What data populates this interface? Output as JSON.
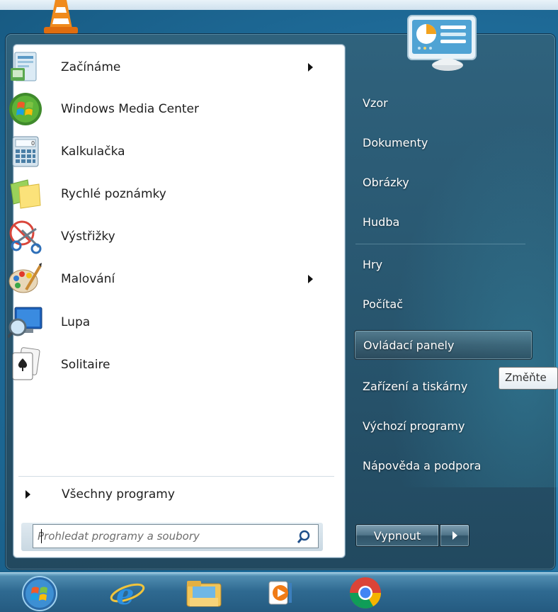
{
  "left_programs": [
    {
      "label": "Začínáme",
      "icon": "getting-started-icon",
      "has_submenu": true
    },
    {
      "label": "Windows Media Center",
      "icon": "windows-media-center-icon",
      "has_submenu": false
    },
    {
      "label": "Kalkulačka",
      "icon": "calculator-icon",
      "has_submenu": false
    },
    {
      "label": "Rychlé poznámky",
      "icon": "sticky-notes-icon",
      "has_submenu": false
    },
    {
      "label": "Výstřižky",
      "icon": "snipping-tool-icon",
      "has_submenu": false
    },
    {
      "label": "Malování",
      "icon": "paint-icon",
      "has_submenu": true
    },
    {
      "label": "Lupa",
      "icon": "magnifier-icon",
      "has_submenu": false
    },
    {
      "label": "Solitaire",
      "icon": "solitaire-icon",
      "has_submenu": false
    }
  ],
  "all_programs": {
    "label": "Všechny programy"
  },
  "search": {
    "placeholder": "Prohledat programy a soubory",
    "value": ""
  },
  "right_items": [
    {
      "label": "Vzor"
    },
    {
      "label": "Dokumenty"
    },
    {
      "label": "Obrázky"
    },
    {
      "label": "Hudba"
    },
    {
      "label": "Hry"
    },
    {
      "label": "Počítač"
    },
    {
      "label": "Ovládací panely"
    },
    {
      "label": "Zařízení a tiskárny"
    },
    {
      "label": "Výchozí programy"
    },
    {
      "label": "Nápověda a podpora"
    }
  ],
  "hovered_right_item": "Ovládací panely",
  "tooltip": {
    "text": "Změňte"
  },
  "shutdown": {
    "label": "Vypnout"
  },
  "taskbar": {
    "items": [
      "start-orb-icon",
      "internet-explorer-icon",
      "file-explorer-icon",
      "media-player-icon",
      "chrome-icon"
    ]
  },
  "colors": {
    "right_pane": "#2d5e7a",
    "left_pane": "#ffffff",
    "taskbar": "#2f6a91"
  }
}
